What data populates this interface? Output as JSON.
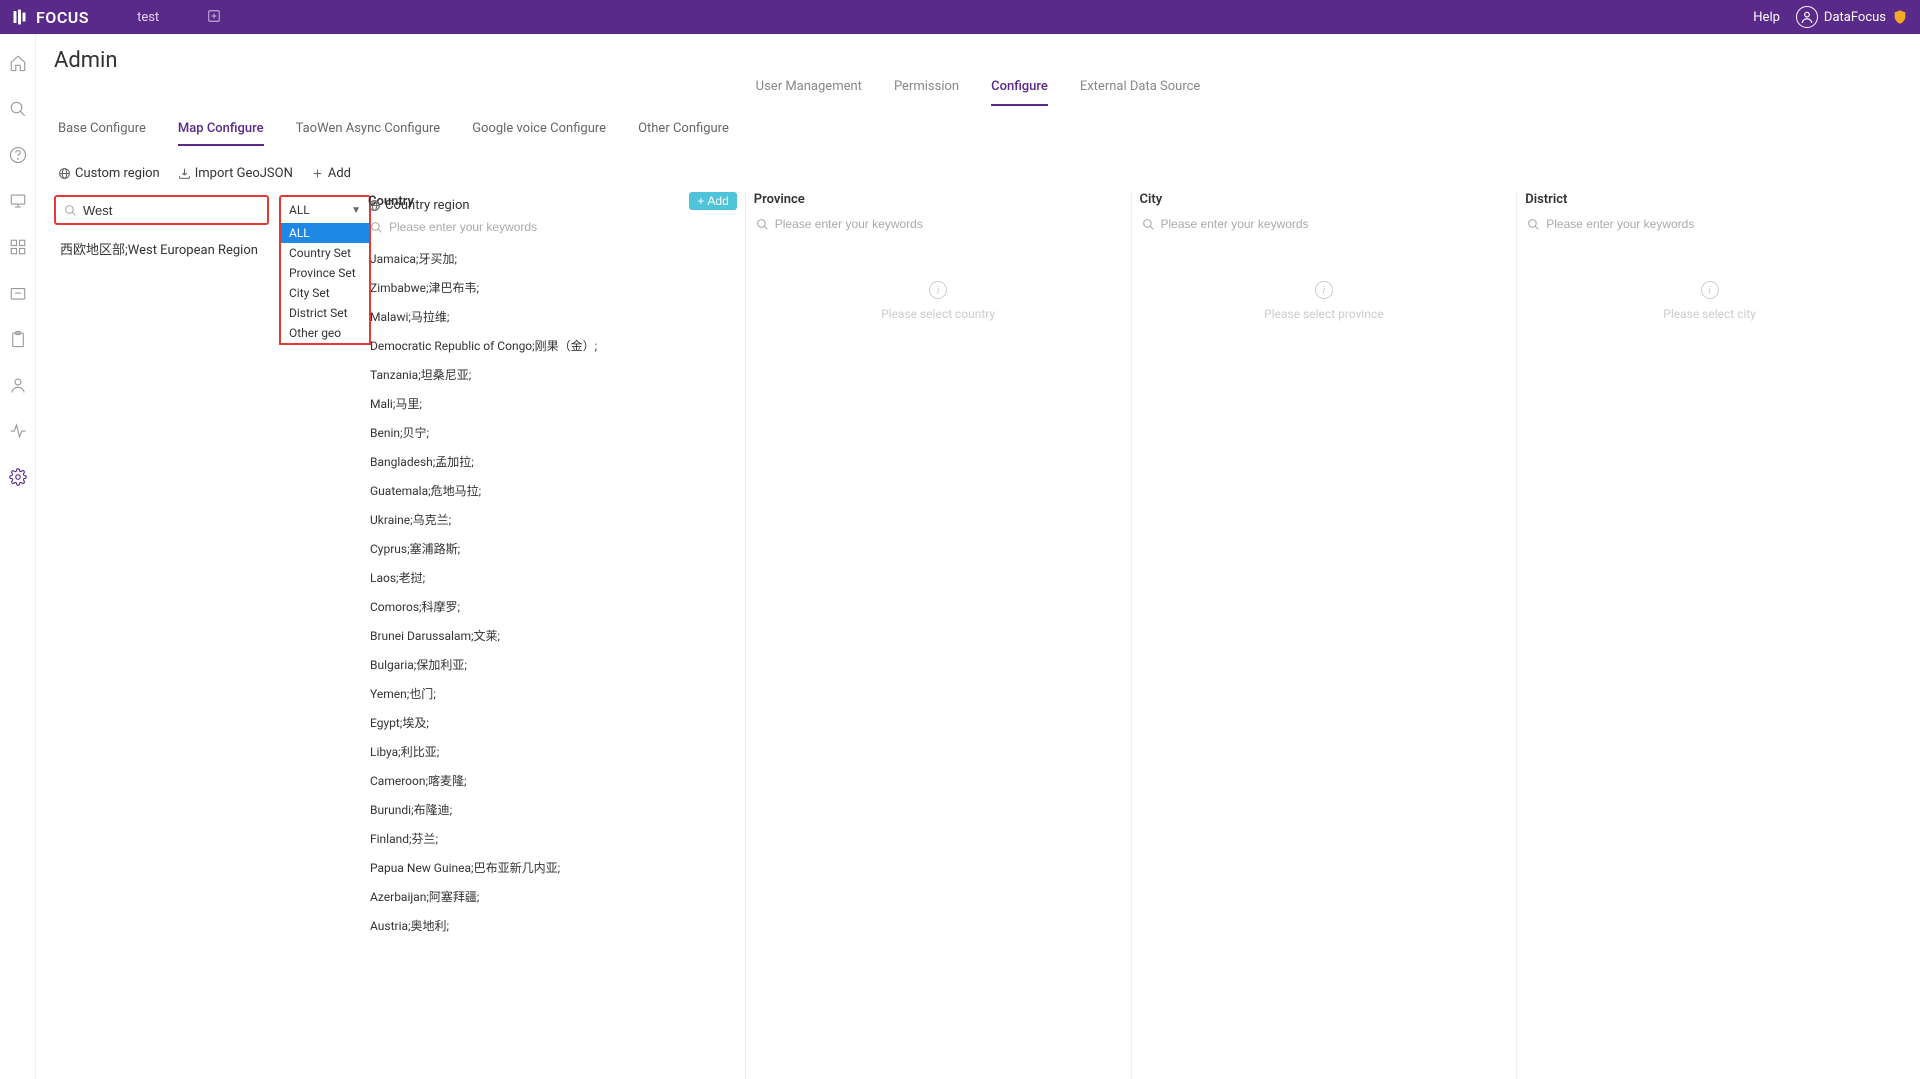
{
  "top": {
    "logo": "FOCUS",
    "tab": "test",
    "help": "Help",
    "username": "DataFocus"
  },
  "page_title": "Admin",
  "main_tabs": [
    {
      "label": "User Management",
      "active": false
    },
    {
      "label": "Permission",
      "active": false
    },
    {
      "label": "Configure",
      "active": true
    },
    {
      "label": "External Data Source",
      "active": false
    }
  ],
  "sub_tabs": [
    {
      "label": "Base Configure",
      "active": false
    },
    {
      "label": "Map Configure",
      "active": true
    },
    {
      "label": "TaoWen Async Configure",
      "active": false
    },
    {
      "label": "Google voice Configure",
      "active": false
    },
    {
      "label": "Other Configure",
      "active": false
    }
  ],
  "left": {
    "custom_region": "Custom region",
    "import_geojson": "Import GeoJSON",
    "add": "Add",
    "search_value": "West",
    "dropdown_value": "ALL",
    "dropdown_options": [
      "ALL",
      "Country Set",
      "Province Set",
      "City Set",
      "District Set",
      "Other geo"
    ],
    "region_result": "西欧地区部;West European Region"
  },
  "right": {
    "country_region": "Country region",
    "columns": {
      "country": {
        "title": "Country",
        "add": "Add",
        "placeholder": "Please enter your keywords",
        "items": [
          "Jamaica;牙买加;",
          "Zimbabwe;津巴布韦;",
          "Malawi;马拉维;",
          "Democratic Republic of Congo;刚果（金）;",
          "Tanzania;坦桑尼亚;",
          "Mali;马里;",
          "Benin;贝宁;",
          "Bangladesh;孟加拉;",
          "Guatemala;危地马拉;",
          "Ukraine;乌克兰;",
          "Cyprus;塞浦路斯;",
          "Laos;老挝;",
          "Comoros;科摩罗;",
          "Brunei Darussalam;文莱;",
          "Bulgaria;保加利亚;",
          "Yemen;也门;",
          "Egypt;埃及;",
          "Libya;利比亚;",
          "Cameroon;喀麦隆;",
          "Burundi;布隆迪;",
          "Finland;芬兰;",
          "Papua New Guinea;巴布亚新几内亚;",
          "Azerbaijan;阿塞拜疆;",
          "Austria;奥地利;"
        ]
      },
      "province": {
        "title": "Province",
        "placeholder": "Please enter your keywords",
        "empty": "Please select country"
      },
      "city": {
        "title": "City",
        "placeholder": "Please enter your keywords",
        "empty": "Please select province"
      },
      "district": {
        "title": "District",
        "placeholder": "Please enter your keywords",
        "empty": "Please select city"
      }
    }
  }
}
